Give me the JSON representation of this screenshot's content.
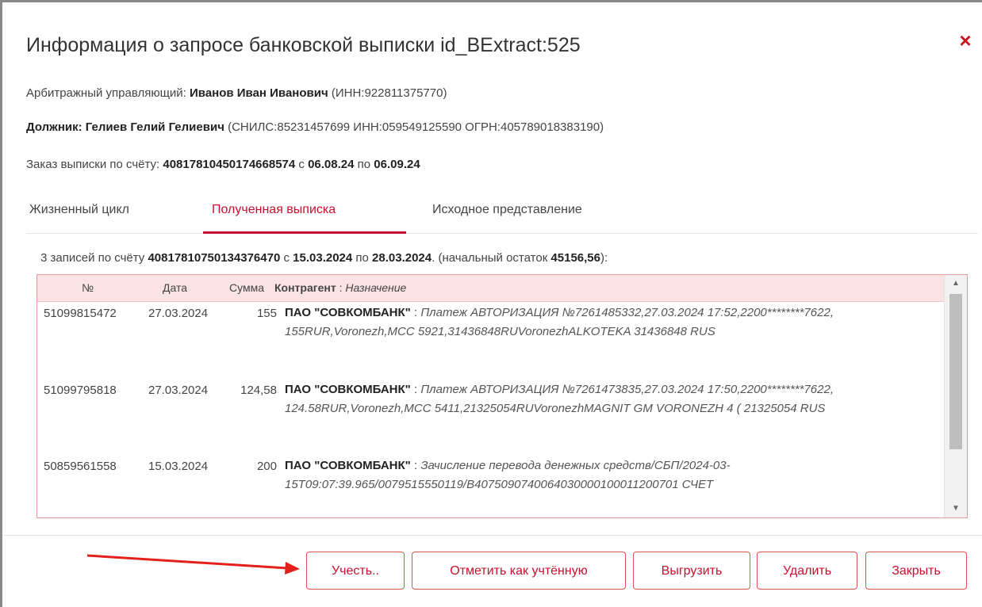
{
  "dialog": {
    "title": "Информация о запросе банковской выписки id_BExtract:525",
    "close_icon": "×"
  },
  "info": {
    "manager_label": "Арбитражный управляющий: ",
    "manager_name": "Иванов Иван Иванович",
    "manager_inn": " (ИНН:922811375770)",
    "debtor_label": "Должник: ",
    "debtor_name": "Гелиев Гелий Гелиевич",
    "debtor_ids": " (СНИЛС:85231457699 ИНН:059549125590 ОГРН:405789018383190)",
    "order_label": "Заказ выписки по счёту: ",
    "order_account": "40817810450174668574",
    "order_from_label": " с ",
    "order_from": "06.08.24",
    "order_to_label": " по ",
    "order_to": "06.09.24"
  },
  "tabs": [
    {
      "label": "Жизненный цикл"
    },
    {
      "label": "Полученная выписка"
    },
    {
      "label": "Исходное представление"
    }
  ],
  "summary": {
    "prefix": "3 записей по счёту ",
    "account": "40817810750134376470",
    "from_label": " с ",
    "from": "15.03.2024",
    "to_label": " по ",
    "to": "28.03.2024",
    "balance_prefix": ". (начальный остаток ",
    "balance": "45156,56",
    "suffix": "):"
  },
  "table": {
    "headers": {
      "num": "№",
      "date": "Дата",
      "sum": "Сумма",
      "counterparty": "Контрагент",
      "sep": " : ",
      "purpose": "Назначение"
    },
    "rows": [
      {
        "num": "51099815472",
        "date": "27.03.2024",
        "sum": "155",
        "counterparty": "ПАО \"СОВКОМБАНК\"",
        "purpose": "Платеж АВТОРИЗАЦИЯ №7261485332,27.03.2024 17:52,2200********7622, 155RUR,Voronezh,MCC 5921,31436848RUVoronezhALKOTEKA 31436848 RUS"
      },
      {
        "num": "51099795818",
        "date": "27.03.2024",
        "sum": "124,58",
        "counterparty": "ПАО \"СОВКОМБАНК\"",
        "purpose": "Платеж АВТОРИЗАЦИЯ №7261473835,27.03.2024 17:50,2200********7622, 124.58RUR,Voronezh,MCC 5411,21325054RUVoronezhMAGNIT GM VORONEZH 4 ( 21325054 RUS"
      },
      {
        "num": "50859561558",
        "date": "15.03.2024",
        "sum": "200",
        "counterparty": "ПАО \"СОВКОМБАНК\"",
        "purpose": "Зачисление перевода денежных средств/СБП/2024-03-15T09:07:39.965/0079515550119/B4075090740064030000100011200701 СЧЕТ"
      }
    ]
  },
  "buttons": {
    "account": "Учесть..",
    "mark": "Отметить как учтённую",
    "export": "Выгрузить",
    "delete": "Удалить",
    "close": "Закрыть"
  },
  "colors": {
    "accent": "#c8102e",
    "header_bg": "#fbe3e3",
    "annotation_arrow": "#e3201b"
  }
}
